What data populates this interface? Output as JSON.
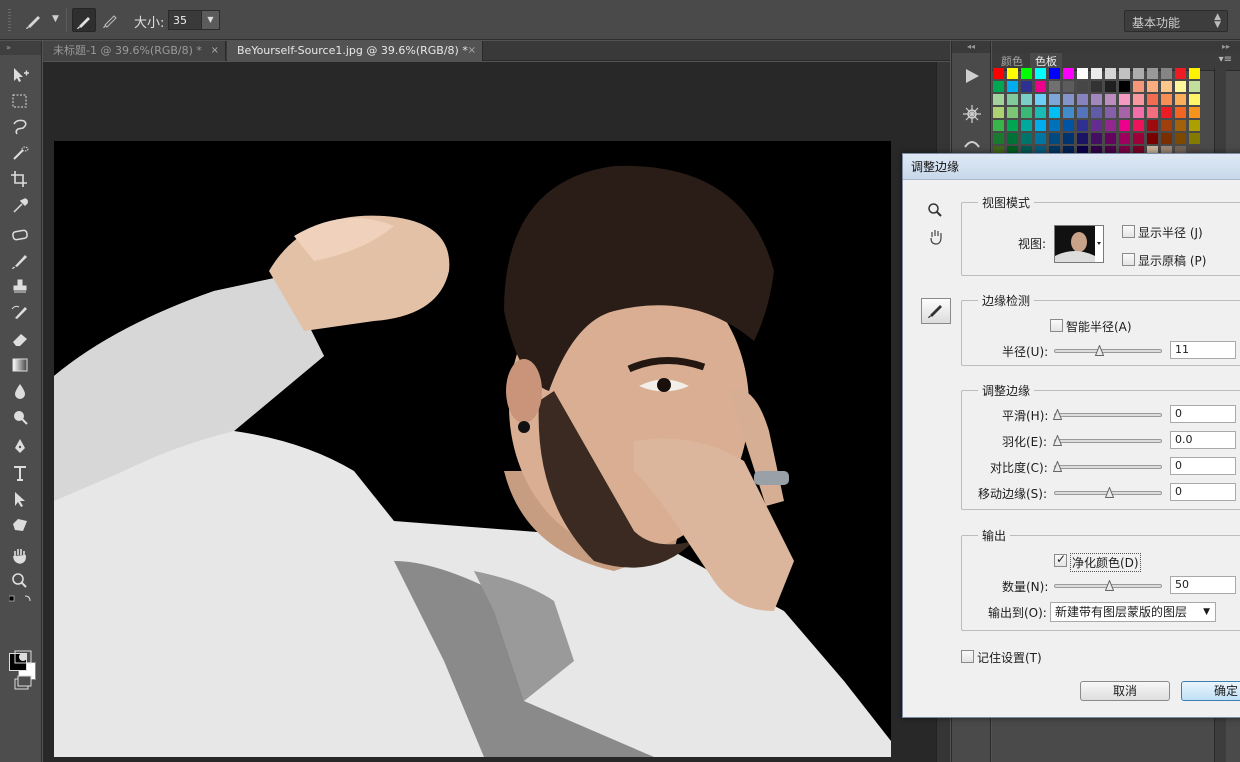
{
  "options_bar": {
    "size_label": "大小:",
    "size_value": "35",
    "workspace": "基本功能"
  },
  "tabs": [
    {
      "label": "未标题-1 @ 39.6%(RGB/8) *",
      "close": "×"
    },
    {
      "label": "BeYourself-Source1.jpg @ 39.6%(RGB/8) *",
      "close": "×"
    }
  ],
  "panel": {
    "tabs": [
      "颜色",
      "色板"
    ],
    "active_tab": "色板"
  },
  "dialog": {
    "title": "调整边缘",
    "view_mode": {
      "title": "视图模式",
      "view_label": "视图:",
      "show_radius": "显示半径 (J)",
      "show_original": "显示原稿 (P)"
    },
    "edge_detection": {
      "title": "边缘检测",
      "smart_radius": "智能半径(A)",
      "radius_label": "半径(U):",
      "radius_value": "11"
    },
    "adjust_edge": {
      "title": "调整边缘",
      "smooth_label": "平滑(H):",
      "smooth_value": "0",
      "feather_label": "羽化(E):",
      "feather_value": "0.0",
      "contrast_label": "对比度(C):",
      "contrast_value": "0",
      "shift_label": "移动边缘(S):",
      "shift_value": "0"
    },
    "output": {
      "title": "输出",
      "decontaminate": "净化颜色(D)",
      "amount_label": "数量(N):",
      "amount_value": "50",
      "output_to_label": "输出到(O):",
      "output_to_value": "新建带有图层蒙版的图层"
    },
    "remember": "记住设置(T)",
    "cancel": "取消",
    "ok": "确定"
  }
}
